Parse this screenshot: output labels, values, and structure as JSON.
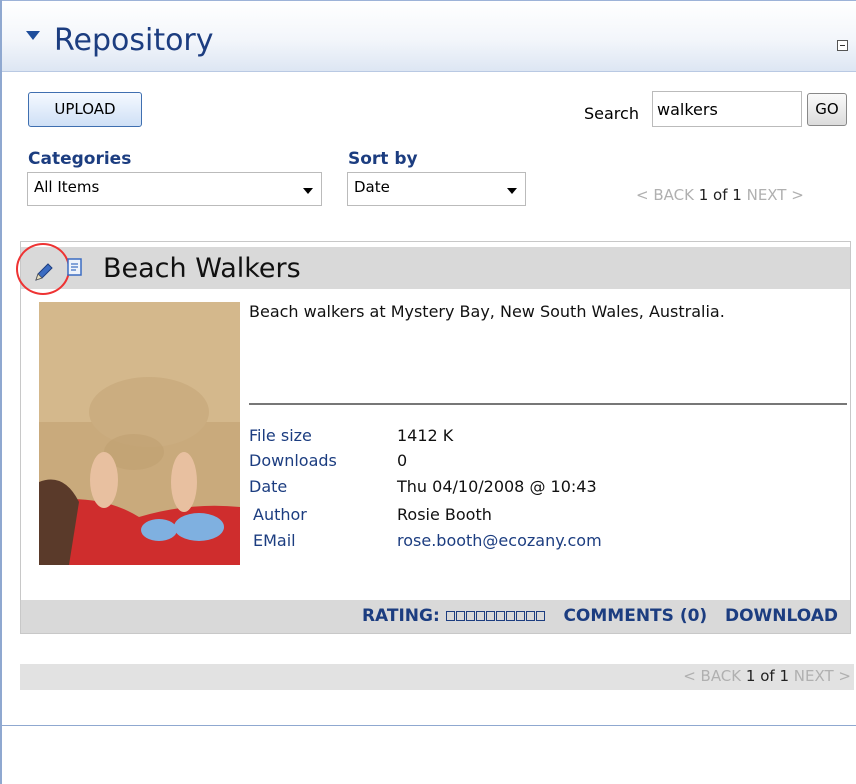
{
  "header": {
    "title": "Repository"
  },
  "toolbar": {
    "upload_label": "UPLOAD"
  },
  "search": {
    "label": "Search",
    "value": "walkers",
    "go_label": "GO"
  },
  "filters": {
    "categories_label": "Categories",
    "categories_selected": "All Items",
    "sort_label": "Sort by",
    "sort_selected": "Date"
  },
  "pager_top": {
    "back": "< BACK",
    "current": "1 of 1",
    "next": "NEXT >"
  },
  "item": {
    "title": "Beach Walkers",
    "description": "Beach walkers at Mystery Bay, New South Wales, Australia.",
    "meta": [
      {
        "key": "File size",
        "value": "1412 K"
      },
      {
        "key": "Downloads",
        "value": "0"
      },
      {
        "key": "Date",
        "value": "Thu 04/10/2008 @ 10:43"
      },
      {
        "key": "Author",
        "value": "Rosie Booth"
      },
      {
        "key": "EMail",
        "value": "rose.booth@ecozany.com"
      }
    ],
    "rating_label": "RATING:",
    "rating_value": 0,
    "rating_max": 10,
    "comments_label": "COMMENTS (0)",
    "download_label": "DOWNLOAD"
  },
  "pager_bottom": {
    "back": "< BACK",
    "current": "1 of 1",
    "next": "NEXT >"
  },
  "colors": {
    "accent": "#1c3d80",
    "highlight_circle": "#e33333",
    "panel_bar": "#d9d9d9"
  }
}
